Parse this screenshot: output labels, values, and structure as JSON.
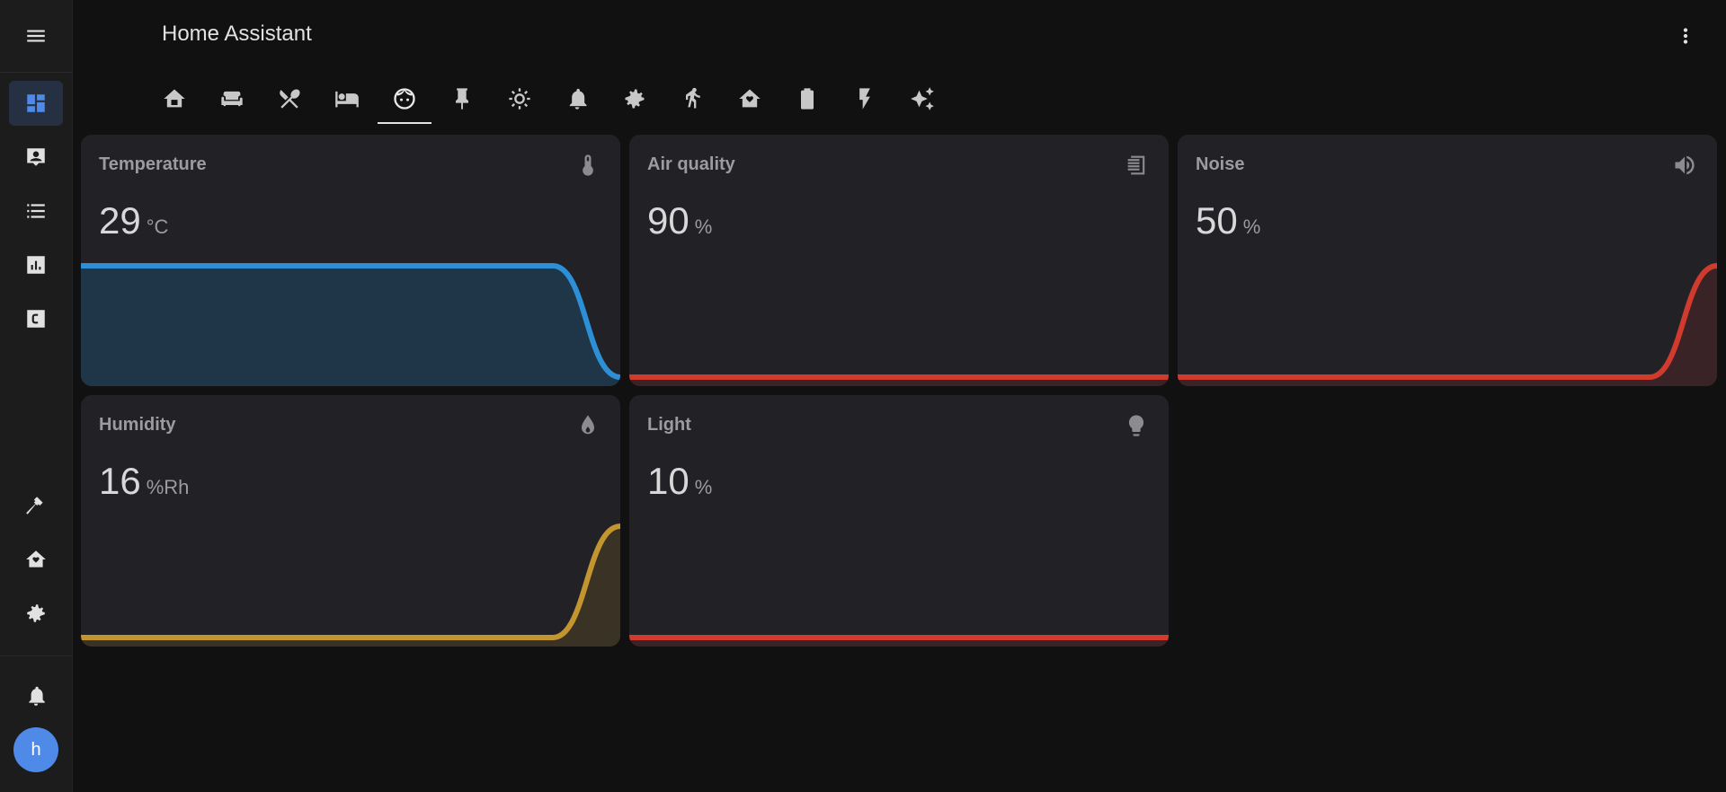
{
  "app": {
    "title": "Home Assistant"
  },
  "sidebar": {
    "items": [
      {
        "name": "sidebar-item-overview",
        "icon": "dashboard-icon",
        "active": true
      },
      {
        "name": "sidebar-item-map",
        "icon": "account-box-icon"
      },
      {
        "name": "sidebar-item-logbook",
        "icon": "list-icon"
      },
      {
        "name": "sidebar-item-history",
        "icon": "chart-bar-icon"
      },
      {
        "name": "sidebar-item-custom",
        "icon": "c-box-icon"
      },
      {
        "name": "sidebar-item-developer-tools",
        "icon": "hammer-icon"
      },
      {
        "name": "sidebar-item-home",
        "icon": "home-heart-icon"
      },
      {
        "name": "sidebar-item-settings",
        "icon": "gear-icon"
      },
      {
        "name": "sidebar-item-notifications",
        "icon": "bell-icon"
      }
    ],
    "avatar_initial": "h"
  },
  "tabs": [
    {
      "icon": "home-icon"
    },
    {
      "icon": "sofa-icon"
    },
    {
      "icon": "silverware-icon"
    },
    {
      "icon": "bed-icon"
    },
    {
      "icon": "face-icon",
      "active": true
    },
    {
      "icon": "pin-icon"
    },
    {
      "icon": "brightness-icon"
    },
    {
      "icon": "bell-icon"
    },
    {
      "icon": "gear-icon"
    },
    {
      "icon": "walk-icon"
    },
    {
      "icon": "home-heart-icon"
    },
    {
      "icon": "battery-icon"
    },
    {
      "icon": "lightning-icon"
    },
    {
      "icon": "sparkles-icon"
    }
  ],
  "cards": [
    {
      "name": "Temperature",
      "value": "29",
      "unit": "°C",
      "icon": "thermometer-icon",
      "color": "#2d8fd5",
      "fill": "#1f3548",
      "trend": [
        1,
        1,
        1,
        1,
        1,
        1,
        1,
        1,
        0
      ]
    },
    {
      "name": "Air quality",
      "value": "90",
      "unit": "%",
      "icon": "air-filter-icon",
      "color": "#d13b2e",
      "fill": "#3a2326",
      "trend": [
        0,
        0,
        0,
        0,
        0,
        0,
        0,
        0,
        0
      ]
    },
    {
      "name": "Noise",
      "value": "50",
      "unit": "%",
      "icon": "volume-icon",
      "color": "#d13b2e",
      "fill": "#3a2326",
      "trend": [
        0,
        0,
        0,
        0,
        0,
        0,
        0,
        0,
        1
      ]
    },
    {
      "name": "Humidity",
      "value": "16",
      "unit": "%Rh",
      "icon": "water-icon",
      "color": "#c2952f",
      "fill": "#3a3225",
      "trend": [
        0,
        0,
        0,
        0,
        0,
        0,
        0,
        0,
        1
      ]
    },
    {
      "name": "Light",
      "value": "10",
      "unit": "%",
      "icon": "lightbulb-icon",
      "color": "#d13b2e",
      "fill": "#3a2326",
      "trend": [
        0,
        0,
        0,
        0,
        0,
        0,
        0,
        0,
        0
      ]
    }
  ]
}
